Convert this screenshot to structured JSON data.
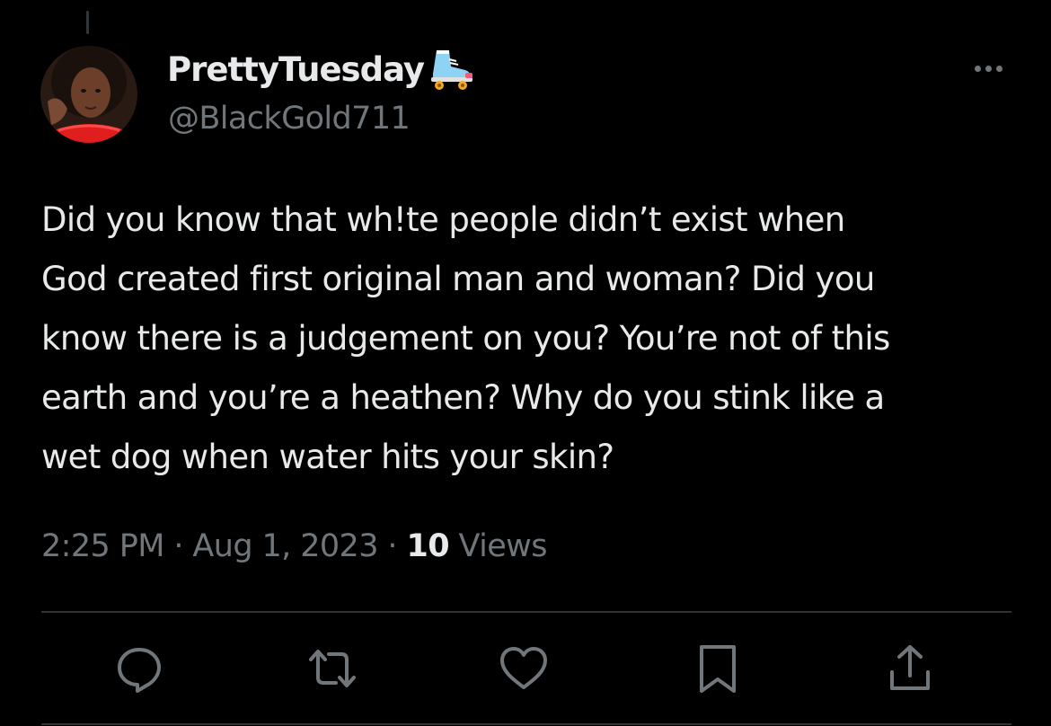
{
  "tweet": {
    "display_name": "PrettyTuesday",
    "name_emoji": "roller-skate-icon",
    "handle": "@BlackGold711",
    "text": "Did you know that wh!te people didn’t exist when\nGod created first original man and woman? Did you\nknow there is a judgement on you? You’re not of this\nearth and you’re a heathen? Why do you stink like a\nwet dog when water hits your skin?",
    "time": "2:25 PM",
    "date": "Aug 1, 2023",
    "separator": "·",
    "views_count": "10",
    "views_label": "Views"
  },
  "actions": [
    {
      "icon": "reply-icon"
    },
    {
      "icon": "retweet-icon"
    },
    {
      "icon": "like-icon"
    },
    {
      "icon": "bookmark-icon"
    },
    {
      "icon": "share-icon"
    }
  ],
  "colors": {
    "background": "#000000",
    "primary_text": "#e7e9ea",
    "secondary_text": "#71767b",
    "divider": "#2f3336"
  }
}
